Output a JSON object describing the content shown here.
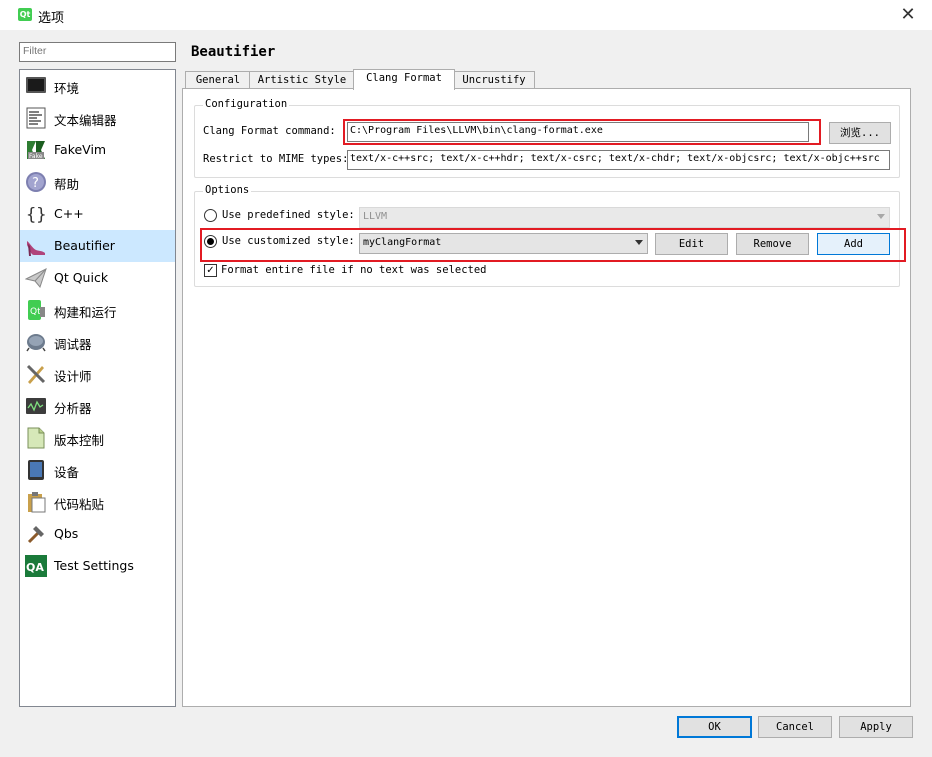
{
  "window": {
    "title": "选项",
    "app_icon_text": "Qt"
  },
  "filter": {
    "placeholder": "Filter"
  },
  "categories": [
    {
      "label": "环境",
      "icon": "monitor-icon"
    },
    {
      "label": "文本编辑器",
      "icon": "text-editor-icon"
    },
    {
      "label": "FakeVim",
      "icon": "fakevim-icon"
    },
    {
      "label": "帮助",
      "icon": "help-icon"
    },
    {
      "label": "C++",
      "icon": "braces-icon"
    },
    {
      "label": "Beautifier",
      "icon": "high-heel-icon",
      "selected": true
    },
    {
      "label": "Qt Quick",
      "icon": "paper-plane-icon"
    },
    {
      "label": "构建和运行",
      "icon": "build-run-icon"
    },
    {
      "label": "调试器",
      "icon": "debugger-bug-icon"
    },
    {
      "label": "设计师",
      "icon": "designer-tools-icon"
    },
    {
      "label": "分析器",
      "icon": "analyzer-icon"
    },
    {
      "label": "版本控制",
      "icon": "version-control-icon"
    },
    {
      "label": "设备",
      "icon": "device-icon"
    },
    {
      "label": "代码粘贴",
      "icon": "code-paste-icon"
    },
    {
      "label": "Qbs",
      "icon": "hammer-icon"
    },
    {
      "label": "Test Settings",
      "icon": "qa-icon"
    }
  ],
  "page": {
    "title": "Beautifier",
    "tabs": [
      {
        "label": "General"
      },
      {
        "label": "Artistic Style"
      },
      {
        "label": "Clang Format",
        "active": true
      },
      {
        "label": "Uncrustify"
      }
    ]
  },
  "configuration": {
    "title": "Configuration",
    "command_label": "Clang Format command:",
    "command_value": "C:\\Program Files\\LLVM\\bin\\clang-format.exe",
    "browse_label": "浏览...",
    "mime_label": "Restrict to MIME types:",
    "mime_value": "text/x-c++src; text/x-c++hdr; text/x-csrc; text/x-chdr; text/x-objcsrc; text/x-objc++src"
  },
  "options": {
    "title": "Options",
    "predefined_label": "Use predefined style:",
    "predefined_value": "LLVM",
    "predefined_selected": false,
    "customized_label": "Use customized style:",
    "customized_value": "myClangFormat",
    "customized_selected": true,
    "edit_label": "Edit",
    "remove_label": "Remove",
    "add_label": "Add",
    "format_entire_label": "Format entire file if no text was selected",
    "format_entire_checked": true
  },
  "footer": {
    "ok_label": "OK",
    "cancel_label": "Cancel",
    "apply_label": "Apply"
  },
  "colors": {
    "highlight": "#e21b23",
    "selection": "#cce8ff",
    "accent": "#0078d7"
  }
}
